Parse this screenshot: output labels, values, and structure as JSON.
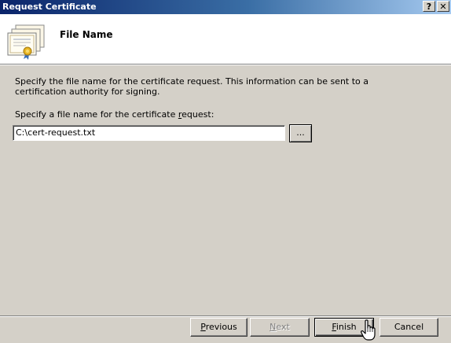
{
  "window": {
    "title": "Request Certificate",
    "help_label": "?",
    "close_label": "✕"
  },
  "header": {
    "title": "File Name",
    "icon": "certificate-icon"
  },
  "content": {
    "description": "Specify the file name for the certificate request. This information can be sent to a certification authority for signing.",
    "field_label_pre": "Specify a file name for the certificate ",
    "field_label_accel": "r",
    "field_label_post": "equest:",
    "file_name_value": "C:\\cert-request.txt",
    "browse_label": "..."
  },
  "buttons": {
    "previous_accel": "P",
    "previous_rest": "revious",
    "next_accel": "N",
    "next_rest": "ext",
    "finish_accel": "F",
    "finish_rest": "inish",
    "cancel": "Cancel"
  },
  "colors": {
    "titlebar_start": "#0a246a",
    "titlebar_end": "#a6caf0",
    "dialog_bg": "#d4d0c8"
  }
}
